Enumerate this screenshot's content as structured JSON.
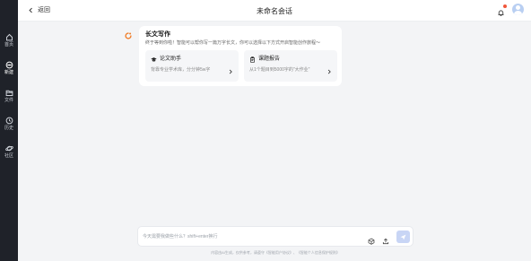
{
  "header": {
    "back_label": "返回",
    "title": "未命名会话"
  },
  "sidebar": {
    "items": [
      {
        "label": "首页",
        "icon": "home-icon"
      },
      {
        "label": "新建",
        "icon": "chat-icon"
      },
      {
        "label": "文件",
        "icon": "folder-icon"
      },
      {
        "label": "历史",
        "icon": "clock-icon"
      },
      {
        "label": "社区",
        "icon": "planet-icon"
      }
    ]
  },
  "card": {
    "title": "长文写作",
    "description": "终于等到你啦！智能可以帮你写一篇万字长文，你可以选择以下方式开启智能创作旅程～",
    "options": [
      {
        "title": "论文助手",
        "description": "背靠专业学术库，分分钟5w字",
        "icon": "graduation-cap-icon"
      },
      {
        "title": "课题报告",
        "description": "从1个题目到5000字的\"大作业\"",
        "icon": "clipboard-icon"
      }
    ]
  },
  "input": {
    "placeholder": "今天需要我做些什么？shift+enter换行",
    "value": ""
  },
  "disclaimer": "内容由AI生成，仅供参考，请遵守《智能用户协议》、《智能个人信息保护规则》",
  "colors": {
    "sidebar_bg": "#1f2229",
    "page_bg": "#f3f4f6",
    "send_button": "#c8d5f5",
    "notification_dot": "#f0563a",
    "logo_accent": "#f07a22"
  }
}
